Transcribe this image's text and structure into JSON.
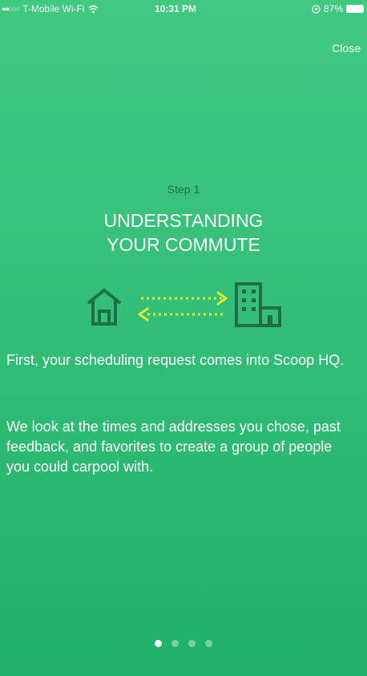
{
  "status_bar": {
    "signal": "●●○○○",
    "carrier": "T-Mobile Wi-Fi",
    "time": "10:31 PM",
    "battery": "87%"
  },
  "header": {
    "close_label": "Close"
  },
  "step": {
    "label": "Step 1",
    "title_line1": "UNDERSTANDING",
    "title_line2": "YOUR COMMUTE"
  },
  "body": {
    "paragraph1": "First, your scheduling request comes into Scoop HQ.",
    "paragraph2": "We look at the times and addresses you chose, past feedback, and favorites to create a group of people you could carpool with."
  },
  "pager": {
    "total": 4,
    "active_index": 0
  },
  "colors": {
    "background_top": "#41c982",
    "background_bottom": "#1fb06a",
    "icon_dark_green": "#1f6e45",
    "arrow_yellow": "#d7ee3c"
  },
  "icons": {
    "house": "house-icon",
    "building": "building-icon",
    "arrows": "two-way-arrows-icon"
  }
}
